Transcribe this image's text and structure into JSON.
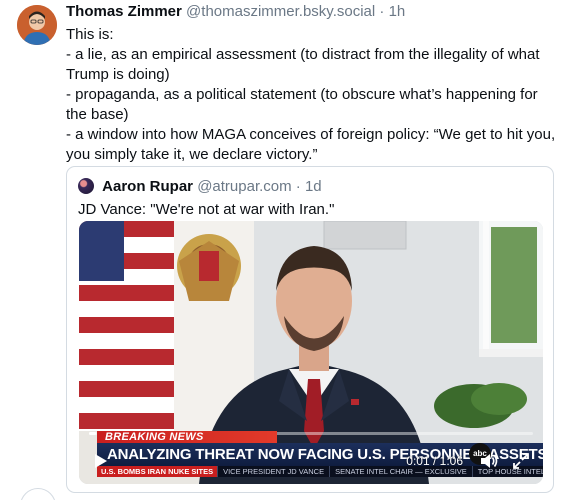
{
  "post": {
    "author_name": "Thomas Zimmer",
    "author_handle": "@thomaszimmer.bsky.social",
    "separator": "·",
    "time": "1h",
    "lines": [
      "This is:",
      "- a lie, as an empirical assessment (to distract from the illegality of what Trump is doing)",
      "- propaganda, as a political statement (to obscure what’s happening for the base)",
      "- a window into how MAGA conceives of foreign policy: “We get to hit you, you simply take it, we declare victory.”"
    ]
  },
  "quote": {
    "author_name": "Aaron Rupar",
    "author_handle": "@atrupar.com",
    "separator": "·",
    "time": "1d",
    "text": "JD Vance: \"We're not at war with Iran.\""
  },
  "video": {
    "breaking_label": "BREAKING NEWS",
    "headline": "ANALYZING THREAT NOW FACING U.S. PERSONNEL, ASSETS IN REGION",
    "ticker_label": "U.S. BOMBS IRAN NUKE SITES",
    "ticker_items": [
      "VICE PRESIDENT JD VANCE",
      "SENATE INTEL CHAIR — EXCLUSIVE",
      "TOP HOUSE INTEL DEM — EXCLUSIVE"
    ],
    "network_logo": "abc",
    "time_readout": "0:01 / 1:06",
    "progress_fraction": 0.016,
    "icons": [
      "play-icon",
      "volume-icon",
      "fullscreen-icon"
    ]
  },
  "colors": {
    "handle_gray": "#6b7886",
    "border": "#d4dbe2",
    "breaking_red": "#c91f1f",
    "headline_navy": "#1c2f5c"
  }
}
